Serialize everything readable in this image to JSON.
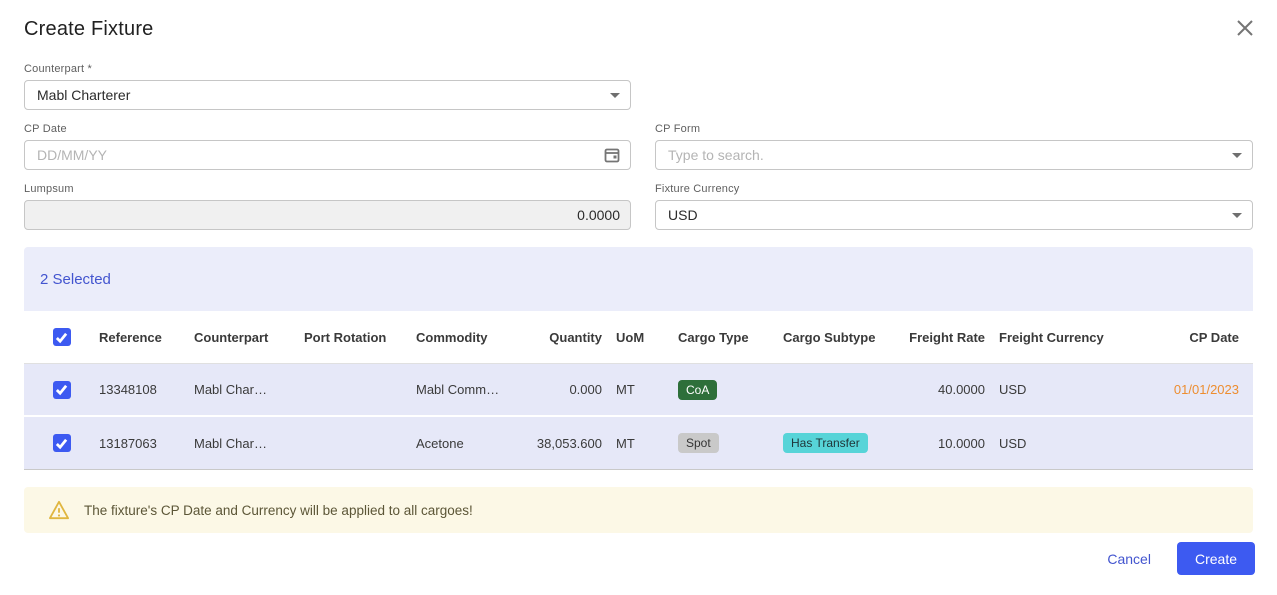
{
  "dialog": {
    "title": "Create Fixture"
  },
  "form": {
    "counterpart": {
      "label": "Counterpart *",
      "value": "Mabl Charterer"
    },
    "cp_date": {
      "label": "CP Date",
      "placeholder": "DD/MM/YY"
    },
    "cp_form": {
      "label": "CP Form",
      "placeholder": "Type to search."
    },
    "lumpsum": {
      "label": "Lumpsum",
      "value": "0.0000"
    },
    "fixture_currency": {
      "label": "Fixture Currency",
      "value": "USD"
    }
  },
  "selection": {
    "summary": "2 Selected"
  },
  "table": {
    "columns": {
      "reference": "Reference",
      "counterpart": "Counterpart",
      "port_rotation": "Port Rotation",
      "commodity": "Commodity",
      "quantity": "Quantity",
      "uom": "UoM",
      "cargo_type": "Cargo Type",
      "cargo_subtype": "Cargo Subtype",
      "freight_rate": "Freight Rate",
      "freight_currency": "Freight Currency",
      "cp_date": "CP Date"
    },
    "rows": [
      {
        "checked": true,
        "reference": "13348108",
        "counterpart": "Mabl Char…",
        "port_rotation": "",
        "commodity": "Mabl Comm…",
        "quantity": "0.000",
        "uom": "MT",
        "cargo_type": "CoA",
        "cargo_subtype": "",
        "freight_rate": "40.0000",
        "freight_currency": "USD",
        "cp_date": "01/01/2023"
      },
      {
        "checked": true,
        "reference": "13187063",
        "counterpart": "Mabl Char…",
        "port_rotation": "",
        "commodity": "Acetone",
        "quantity": "38,053.600",
        "uom": "MT",
        "cargo_type": "Spot",
        "cargo_subtype": "Has Transfer",
        "freight_rate": "10.0000",
        "freight_currency": "USD",
        "cp_date": ""
      }
    ]
  },
  "badge_styles": {
    "CoA": {
      "bg": "#2e6f3a",
      "fg": "#ffffff"
    },
    "Spot": {
      "bg": "#c9c9c9",
      "fg": "#333333"
    },
    "Has Transfer": {
      "bg": "#57d4d8",
      "fg": "#20373a"
    }
  },
  "warning": {
    "text": "The fixture's CP Date and Currency will be applied to all cargoes!"
  },
  "footer": {
    "cancel_label": "Cancel",
    "create_label": "Create"
  },
  "colors": {
    "primary_blue": "#3d5af1",
    "link_blue": "#4355cf",
    "cp_date_orange": "#ed8d30",
    "warning_gold": "#e0b63f"
  }
}
